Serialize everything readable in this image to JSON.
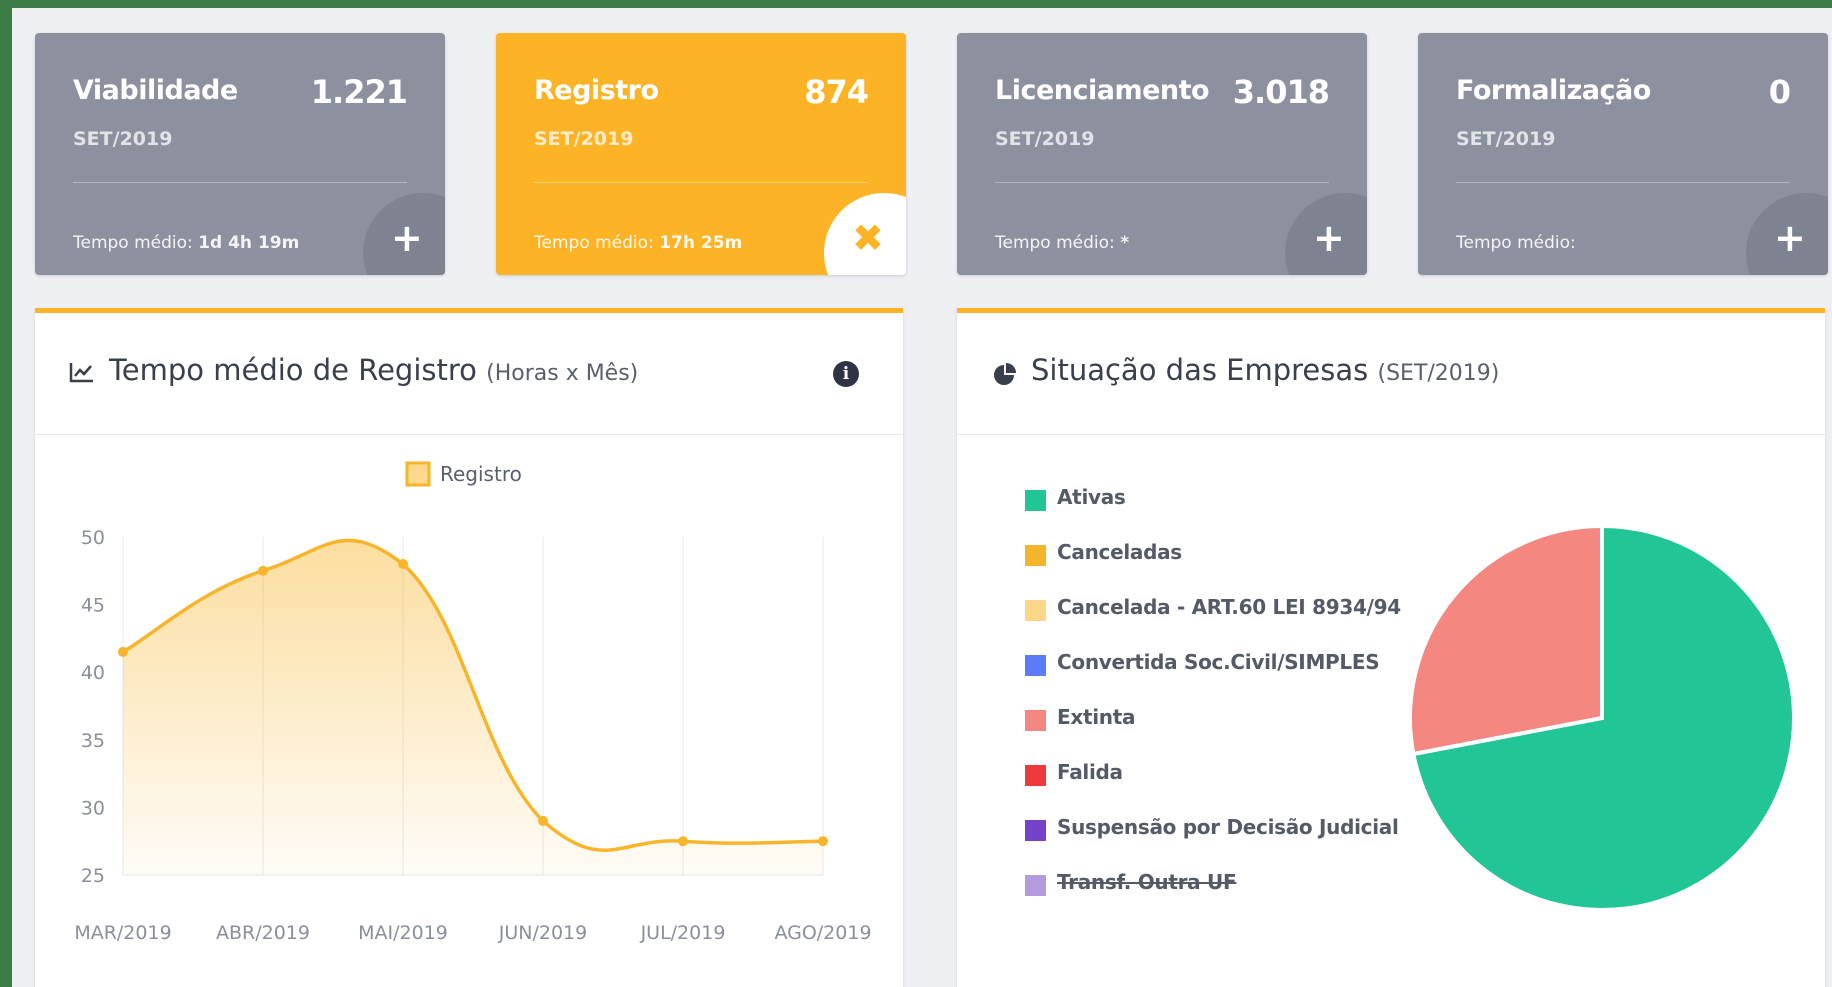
{
  "kpis": [
    {
      "title": "Viabilidade",
      "value": "1.221",
      "period": "SET/2019",
      "avg_label": "Tempo médio:",
      "avg_value": "1d 4h 19m",
      "action": "+",
      "active": false
    },
    {
      "title": "Registro",
      "value": "874",
      "period": "SET/2019",
      "avg_label": "Tempo médio:",
      "avg_value": "17h 25m",
      "action": "✖",
      "active": true
    },
    {
      "title": "Licenciamento",
      "value": "3.018",
      "period": "SET/2019",
      "avg_label": "Tempo médio:",
      "avg_value": "*",
      "action": "+",
      "active": false
    },
    {
      "title": "Formalização",
      "value": "0",
      "period": "SET/2019",
      "avg_label": "Tempo médio:",
      "avg_value": "",
      "action": "+",
      "active": false
    }
  ],
  "line_panel": {
    "title": "Tempo médio de Registro",
    "subtitle": "(Horas x Mês)",
    "title_icon": "line-chart-icon",
    "info_icon": "info-icon",
    "info_glyph": "i"
  },
  "pie_panel": {
    "title": "Situação das Empresas",
    "subtitle": "(SET/2019)",
    "title_icon": "pie-chart-icon"
  },
  "colors": {
    "accent": "#fcb426",
    "card_gray": "#8d919f"
  },
  "chart_data": [
    {
      "type": "area",
      "title": "",
      "xlabel": "",
      "ylabel": "",
      "categories": [
        "MAR/2019",
        "ABR/2019",
        "MAI/2019",
        "JUN/2019",
        "JUL/2019",
        "AGO/2019"
      ],
      "series": [
        {
          "name": "Registro",
          "values": [
            41.5,
            47.5,
            48,
            29,
            27.5,
            27.5
          ],
          "color": "#f8b52b"
        }
      ],
      "yticks": [
        25,
        30,
        35,
        40,
        45,
        50
      ],
      "ylim": [
        25,
        50
      ],
      "grid": true,
      "legend": "top-center"
    },
    {
      "type": "pie",
      "title": "",
      "legend": "left",
      "slices": [
        {
          "label": "Ativas",
          "value": 72,
          "color": "#22c595",
          "hidden": false
        },
        {
          "label": "Canceladas",
          "value": 0,
          "color": "#f4b52c",
          "hidden": false
        },
        {
          "label": "Cancelada - ART.60 LEI 8934/94",
          "value": 0,
          "color": "#fcd78a",
          "hidden": false
        },
        {
          "label": "Convertida Soc.Civil/SIMPLES",
          "value": 0,
          "color": "#5b7cf6",
          "hidden": false
        },
        {
          "label": "Extinta",
          "value": 28,
          "color": "#f4877f",
          "hidden": false
        },
        {
          "label": "Falida",
          "value": 0,
          "color": "#ee3a3a",
          "hidden": false
        },
        {
          "label": "Suspensão por Decisão Judicial",
          "value": 0,
          "color": "#7443c9",
          "hidden": false
        },
        {
          "label": "Transf. Outra UF",
          "value": 0,
          "color": "#b49be0",
          "hidden": true
        }
      ]
    }
  ]
}
